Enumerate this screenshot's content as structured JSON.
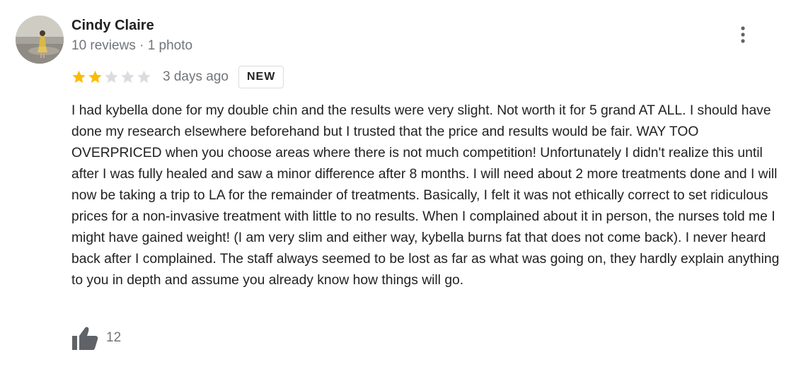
{
  "review": {
    "author": {
      "name": "Cindy Claire",
      "meta": "10 reviews · 1 photo"
    },
    "rating": {
      "value": 2,
      "max": 5,
      "filled_color": "#fbbc04",
      "empty_color": "#dadce0"
    },
    "date": "3 days ago",
    "badge": "NEW",
    "text": "I had kybella done for my double chin and the results were very slight. Not worth it for 5 grand AT ALL. I should have done my research elsewhere beforehand but I trusted that the price and results would be fair. WAY TOO OVERPRICED when you choose areas where there is not much competition! Unfortunately I didn't realize this until after I was fully healed and saw a minor difference after 8 months. I will need about 2 more treatments done and I will now be taking a trip to LA for the remainder of treatments. Basically, I felt it was not ethically correct to set ridiculous prices for a non-invasive treatment with little to no results. When I complained about it in person, the nurses told me I might have gained weight! (I am very slim and either way, kybella burns fat that does not come back). I never heard back after I complained. The staff always seemed to be lost as far as what was going on, they hardly explain anything to you in depth and assume you already know how things will go.",
    "likes": "12",
    "icons": {
      "menu": "more-vert-icon",
      "like": "thumb-up-icon",
      "star": "star-icon"
    }
  }
}
